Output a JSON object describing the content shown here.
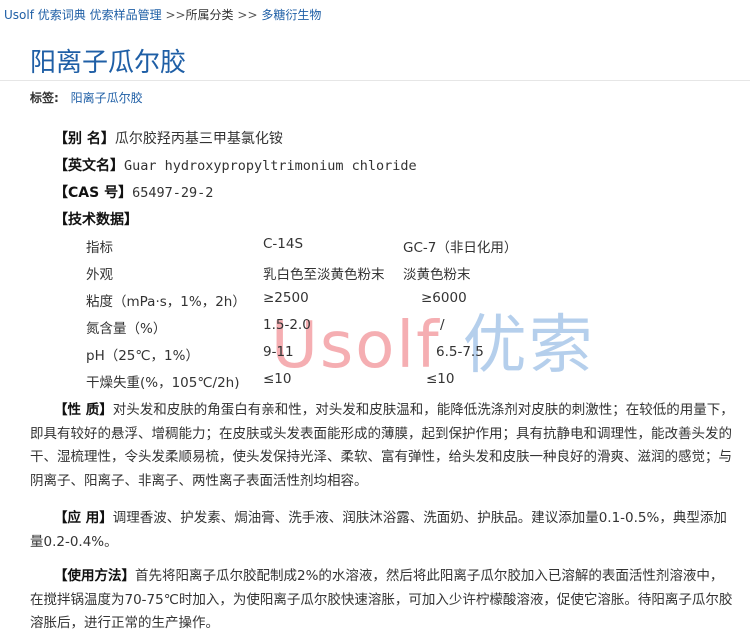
{
  "breadcrumb": {
    "site": "Usolf 优索词典",
    "section": "优索样品管理",
    "sep1": ">>",
    "category": "所属分类",
    "sep2": ">>",
    "subcategory": "多糖衍生物"
  },
  "page": {
    "title": "阳离子瓜尔胶"
  },
  "tags": {
    "label": "标签:",
    "items": [
      "阳离子瓜尔胶"
    ]
  },
  "watermark": {
    "latin": "Usolf",
    "chinese": "优索"
  },
  "fields": {
    "alias_label": "【别  名】",
    "alias_value": "瓜尔胶羟丙基三甲基氯化铵",
    "en_label": "【英文名】",
    "en_value": "Guar hydroxypropyltrimonium chloride",
    "cas_label": "【CAS 号】",
    "cas_value": "65497-29-2",
    "tech_label": "【技术数据】"
  },
  "tech_table": {
    "rows": [
      [
        "指标",
        "C-14S",
        "GC-7（非日化用）"
      ],
      [
        "外观",
        "乳白色至淡黄色粉末",
        "淡黄色粉末"
      ],
      [
        "粘度（mPa·s，1%，2h）",
        "≥2500",
        "≥6000"
      ],
      [
        "氮含量（%）",
        "1.5-2.0",
        "/"
      ],
      [
        "pH（25℃，1%）",
        "9-11",
        "6.5-7.5"
      ],
      [
        "干燥失重(%，105℃/2h)",
        "≤10",
        "≤10"
      ]
    ]
  },
  "properties": {
    "label": "【性  质】",
    "text": "对头发和皮肤的角蛋白有亲和性，对头发和皮肤温和，能降低洗涤剂对皮肤的刺激性；在较低的用量下，即具有较好的悬浮、增稠能力；在皮肤或头发表面能形成的薄膜，起到保护作用；具有抗静电和调理性，能改善头发的干、湿梳理性，令头发柔顺易梳，使头发保持光泽、柔软、富有弹性，给头发和皮肤一种良好的滑爽、滋润的感觉；与阴离子、阳离子、非离子、两性离子表面活性剂均相容。"
  },
  "applications": {
    "label": "【应  用】",
    "text": "调理香波、护发素、焗油膏、洗手液、润肤沐浴露、洗面奶、护肤品。建议添加量0.1-0.5%，典型添加量0.2-0.4%。"
  },
  "usage": {
    "label": "【使用方法】",
    "text": "首先将阳离子瓜尔胶配制成2%的水溶液，然后将此阳离子瓜尔胶加入已溶解的表面活性剂溶液中，在搅拌锅温度为70-75℃时加入，为使阳离子瓜尔胶快速溶胀，可加入少许柠檬酸溶液，促使它溶胀。待阳离子瓜尔胶溶胀后，进行正常的生产操作。"
  }
}
